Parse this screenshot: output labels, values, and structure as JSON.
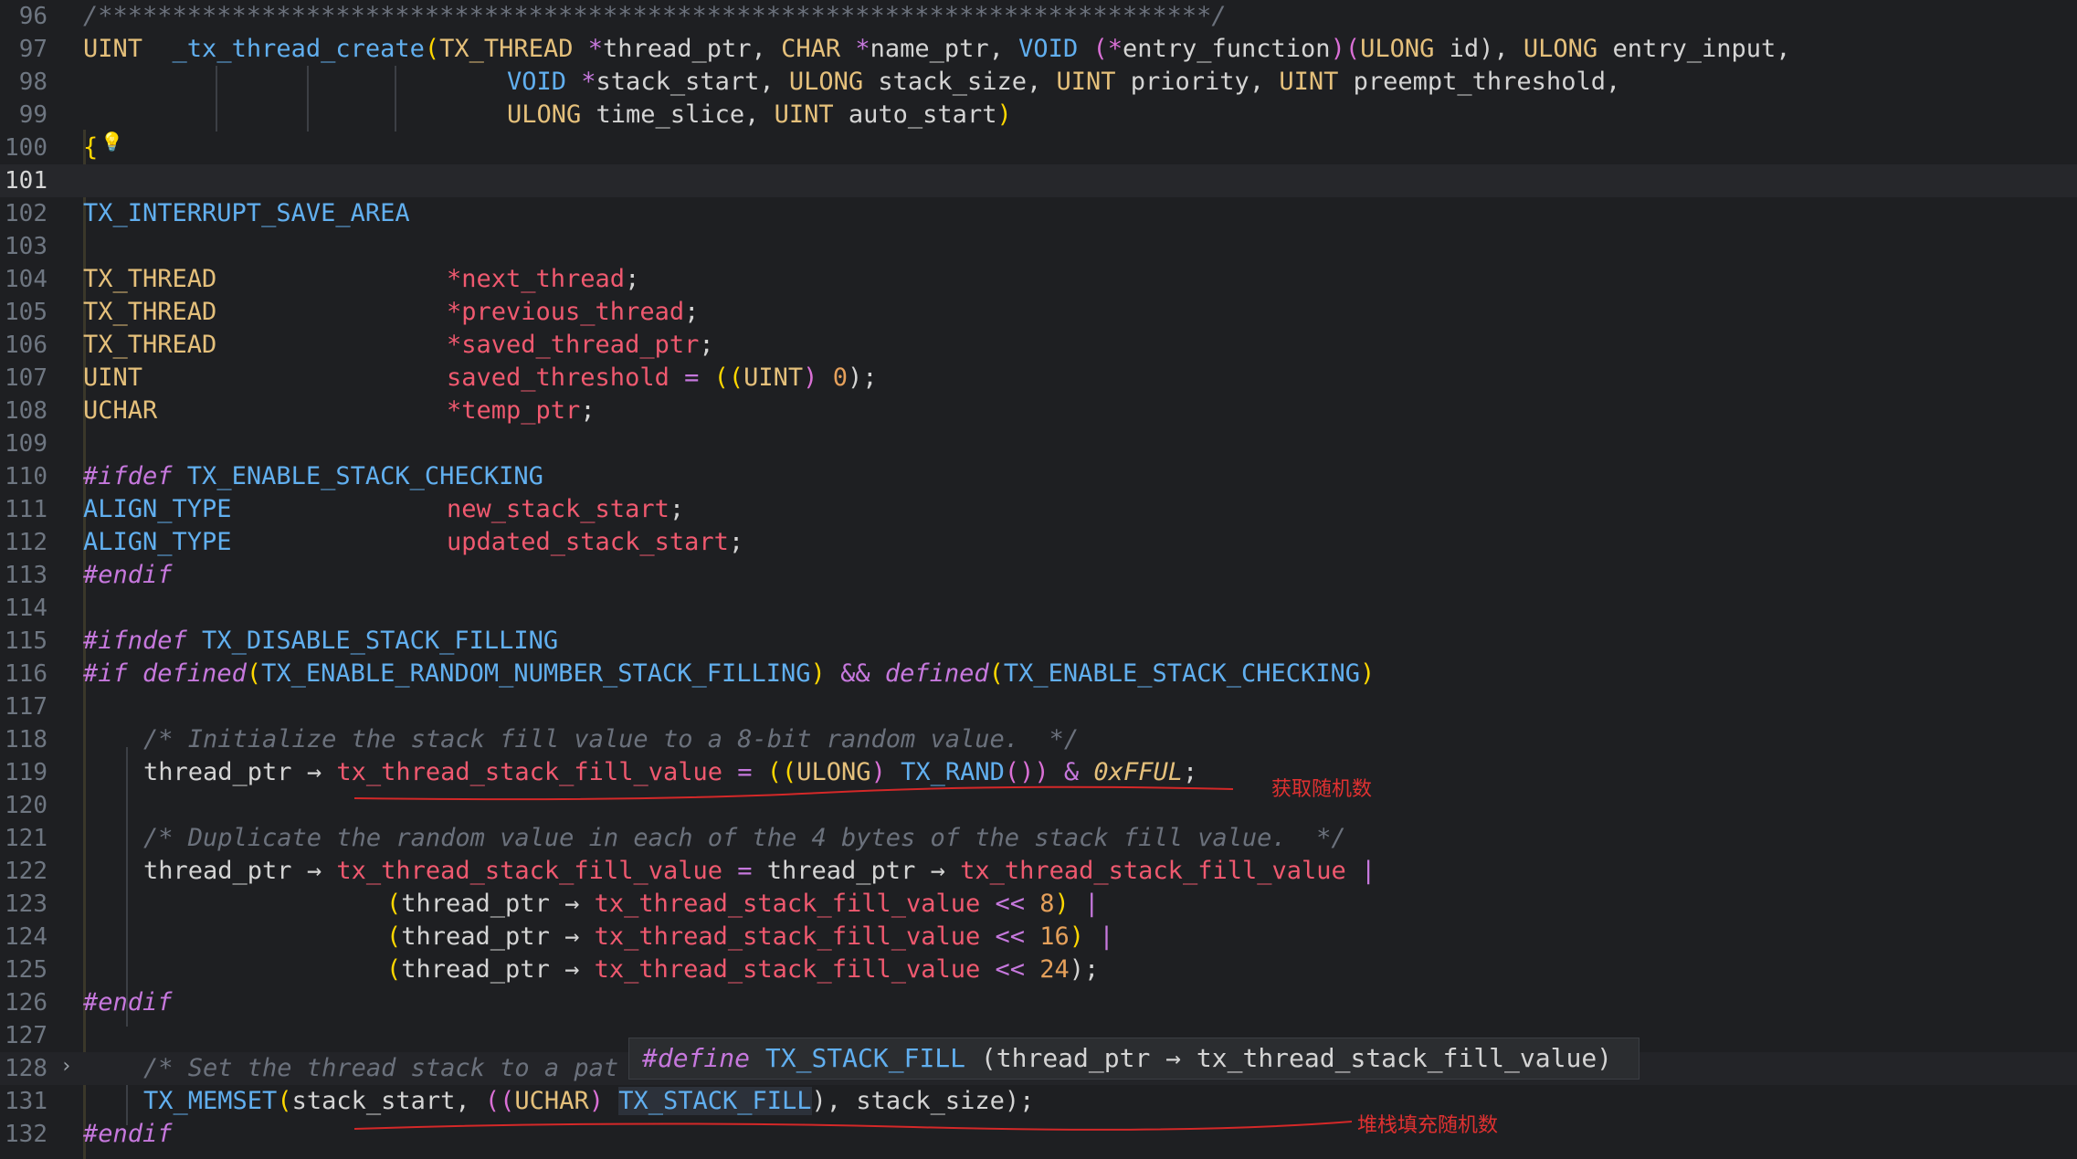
{
  "editor": {
    "current_line": "101",
    "lines": [
      {
        "n": "96"
      },
      {
        "n": "97"
      },
      {
        "n": "98"
      },
      {
        "n": "99"
      },
      {
        "n": "100"
      },
      {
        "n": "101"
      },
      {
        "n": "102"
      },
      {
        "n": "103"
      },
      {
        "n": "104"
      },
      {
        "n": "105"
      },
      {
        "n": "106"
      },
      {
        "n": "107"
      },
      {
        "n": "108"
      },
      {
        "n": "109"
      },
      {
        "n": "110"
      },
      {
        "n": "111"
      },
      {
        "n": "112"
      },
      {
        "n": "113"
      },
      {
        "n": "114"
      },
      {
        "n": "115"
      },
      {
        "n": "116"
      },
      {
        "n": "117"
      },
      {
        "n": "118"
      },
      {
        "n": "119"
      },
      {
        "n": "120"
      },
      {
        "n": "121"
      },
      {
        "n": "122"
      },
      {
        "n": "123"
      },
      {
        "n": "124"
      },
      {
        "n": "125"
      },
      {
        "n": "126"
      },
      {
        "n": "127"
      },
      {
        "n": "128"
      },
      {
        "n": "131"
      },
      {
        "n": "132"
      }
    ]
  },
  "code": {
    "l96": "/***************************************************************************/",
    "l97": [
      "UINT",
      "_tx_thread_create",
      "(",
      "TX_THREAD",
      " *",
      "thread_ptr",
      ", ",
      "CHAR",
      " *",
      "name_ptr",
      ", ",
      "VOID",
      " (*",
      "entry_function",
      ")(",
      "ULONG",
      " id), ",
      "ULONG",
      " entry_input,"
    ],
    "l98": [
      "VOID",
      " *",
      "stack_start",
      ", ",
      "ULONG",
      " stack_size, ",
      "UINT",
      " priority, ",
      "UINT",
      " preempt_threshold,"
    ],
    "l99": [
      "ULONG",
      " time_slice, ",
      "UINT",
      " auto_start",
      ")"
    ],
    "l100": "{",
    "l102": "TX_INTERRUPT_SAVE_AREA",
    "l104": [
      "TX_THREAD",
      "*next_thread",
      ";"
    ],
    "l105": [
      "TX_THREAD",
      "*previous_thread",
      ";"
    ],
    "l106": [
      "TX_THREAD",
      "*saved_thread_ptr",
      ";"
    ],
    "l107": [
      "UINT",
      "saved_threshold",
      " = ",
      "((",
      "UINT",
      ") ",
      "0",
      ");"
    ],
    "l108": [
      "UCHAR",
      "*temp_ptr",
      ";"
    ],
    "l110": [
      "#ifdef",
      " TX_ENABLE_STACK_CHECKING"
    ],
    "l111": [
      "ALIGN_TYPE",
      "new_stack_start",
      ";"
    ],
    "l112": [
      "ALIGN_TYPE",
      "updated_stack_start",
      ";"
    ],
    "l113": "#endif",
    "l115": [
      "#ifndef",
      " TX_DISABLE_STACK_FILLING"
    ],
    "l116": [
      "#if",
      " defined",
      "(",
      "TX_ENABLE_RANDOM_NUMBER_STACK_FILLING",
      ")",
      " && ",
      "defined",
      "(",
      "TX_ENABLE_STACK_CHECKING",
      ")"
    ],
    "l118": "/* Initialize the stack fill value to a 8-bit random value.  */",
    "l119": [
      "thread_ptr",
      " → ",
      "tx_thread_stack_fill_value",
      " = ",
      "((",
      "ULONG",
      ") ",
      "TX_RAND",
      "()) ",
      "&",
      " 0xFFUL",
      ";"
    ],
    "l121": "/* Duplicate the random value in each of the 4 bytes of the stack fill value.  */",
    "l122": [
      "thread_ptr",
      " → ",
      "tx_thread_stack_fill_value",
      " = ",
      "thread_ptr",
      " → ",
      "tx_thread_stack_fill_value",
      " |"
    ],
    "l123": [
      "(",
      "thread_ptr",
      " → ",
      "tx_thread_stack_fill_value",
      " << ",
      "8",
      ")",
      " |"
    ],
    "l124": [
      "(",
      "thread_ptr",
      " → ",
      "tx_thread_stack_fill_value",
      " << ",
      "16",
      ")",
      " |"
    ],
    "l125": [
      "(",
      "thread_ptr",
      " → ",
      "tx_thread_stack_fill_value",
      " << ",
      "24",
      ");"
    ],
    "l126": "#endif",
    "l128": "/* Set the thread stack to a pat",
    "l131": [
      "TX_MEMSET",
      "(",
      "stack_start, ",
      "((",
      "UCHAR",
      ") ",
      "TX_STACK_FILL",
      "), stack_size);"
    ],
    "l132": "#endif"
  },
  "tooltip": {
    "keyword": "#define",
    "name": "TX_STACK_FILL",
    "body": " (thread_ptr → tx_thread_stack_fill_value)"
  },
  "annotations": {
    "random_note": "获取随机数",
    "fill_note": "堆栈填充随机数",
    "color": "#e03131"
  },
  "icons": {
    "lightbulb": "lightbulb-icon",
    "fold": "chevron-right-icon"
  }
}
